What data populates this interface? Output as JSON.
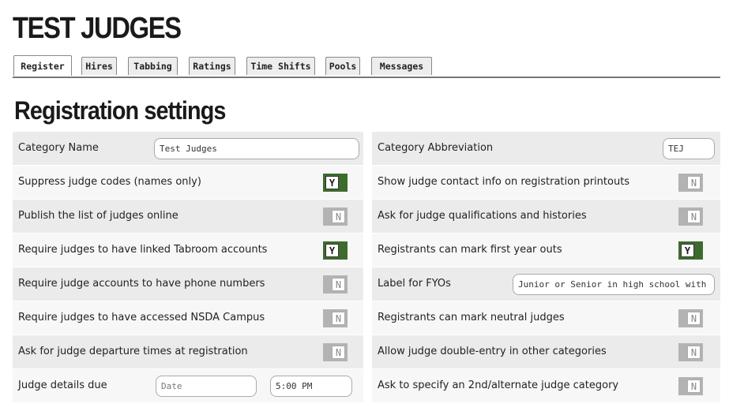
{
  "page": {
    "title": "TEST JUDGES"
  },
  "tabs": [
    {
      "label": "Register",
      "active": true
    },
    {
      "label": "Hires",
      "active": false
    },
    {
      "label": "Tabbing",
      "active": false
    },
    {
      "label": "Ratings",
      "active": false
    },
    {
      "label": "Time Shifts",
      "active": false
    },
    {
      "label": "Pools",
      "active": false
    },
    {
      "label": "Messages",
      "active": false
    }
  ],
  "section": {
    "title": "Registration settings"
  },
  "left": {
    "category_name": {
      "label": "Category Name",
      "value": "Test Judges"
    },
    "suppress_codes": {
      "label": "Suppress judge codes (names only)",
      "value": "Y"
    },
    "publish_list": {
      "label": "Publish the list of judges online",
      "value": "N"
    },
    "require_linked": {
      "label": "Require judges to have linked Tabroom accounts",
      "value": "Y"
    },
    "require_phone": {
      "label": "Require judge accounts to have phone numbers",
      "value": "N"
    },
    "require_campus": {
      "label": "Require judges to have accessed NSDA Campus",
      "value": "N"
    },
    "departure_times": {
      "label": "Ask for judge departure times at registration",
      "value": "N"
    },
    "details_due": {
      "label": "Judge details due",
      "date_placeholder": "Date",
      "time_value": "5:00 PM"
    }
  },
  "right": {
    "category_abbr": {
      "label": "Category Abbreviation",
      "value": "TEJ"
    },
    "contact_info": {
      "label": "Show judge contact info on registration printouts",
      "value": "N"
    },
    "qualifications": {
      "label": "Ask for judge qualifications and histories",
      "value": "N"
    },
    "first_year_outs": {
      "label": "Registrants can mark first year outs",
      "value": "Y"
    },
    "fyo_label": {
      "label": "Label for FYOs",
      "value": "Junior or Senior in high school with"
    },
    "neutral_judges": {
      "label": "Registrants can mark neutral judges",
      "value": "N"
    },
    "double_entry": {
      "label": "Allow judge double-entry in other categories",
      "value": "N"
    },
    "alternate_category": {
      "label": "Ask to specify an 2nd/alternate judge category",
      "value": "N"
    }
  },
  "colors": {
    "toggle_on": "#3d6b2e",
    "toggle_off": "#b3b3b3"
  }
}
